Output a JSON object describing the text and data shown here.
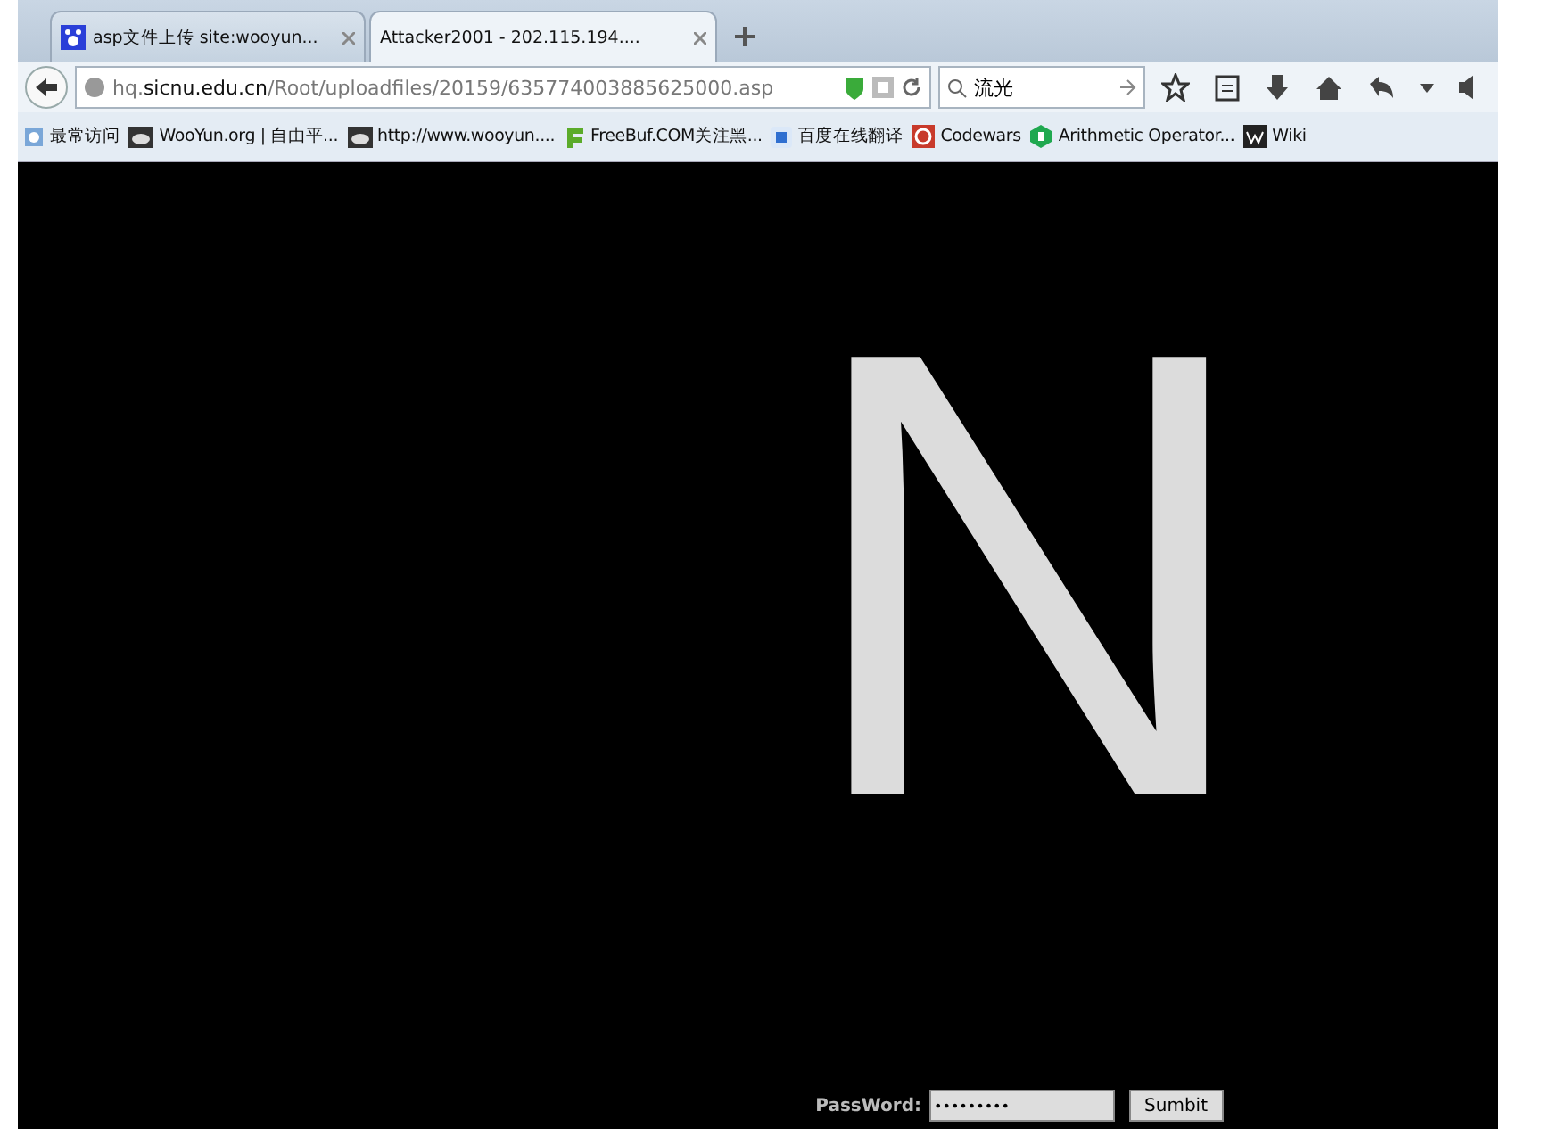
{
  "tabs": [
    {
      "label": "asp文件上传 site:wooyun...",
      "kind": "paw",
      "selected": false
    },
    {
      "label": "Attacker2001 - 202.115.194....",
      "kind": "plain",
      "selected": true
    }
  ],
  "address_bar": {
    "subdomain": "hq.",
    "domain": "sicnu.edu.cn",
    "path": "/Root/uploadfiles/20159/635774003885625000.asp"
  },
  "search": {
    "value": "流光"
  },
  "bookmarks": [
    {
      "label": "最常访问",
      "kind": "folder"
    },
    {
      "label": "WooYun.org | 自由平...",
      "kind": "cloud"
    },
    {
      "label": "http://www.wooyun....",
      "kind": "cloud"
    },
    {
      "label": "FreeBuf.COM关注黑...",
      "kind": "freebuf"
    },
    {
      "label": "百度在线翻译",
      "kind": "translate"
    },
    {
      "label": "Codewars",
      "kind": "codewars"
    },
    {
      "label": "Arithmetic Operator...",
      "kind": "hex"
    },
    {
      "label": "Wiki",
      "kind": "wiki"
    }
  ],
  "page": {
    "big_letter": "N",
    "password_label": "PassWord:",
    "password_value": "•••••••••",
    "submit_label": "Sumbit"
  }
}
